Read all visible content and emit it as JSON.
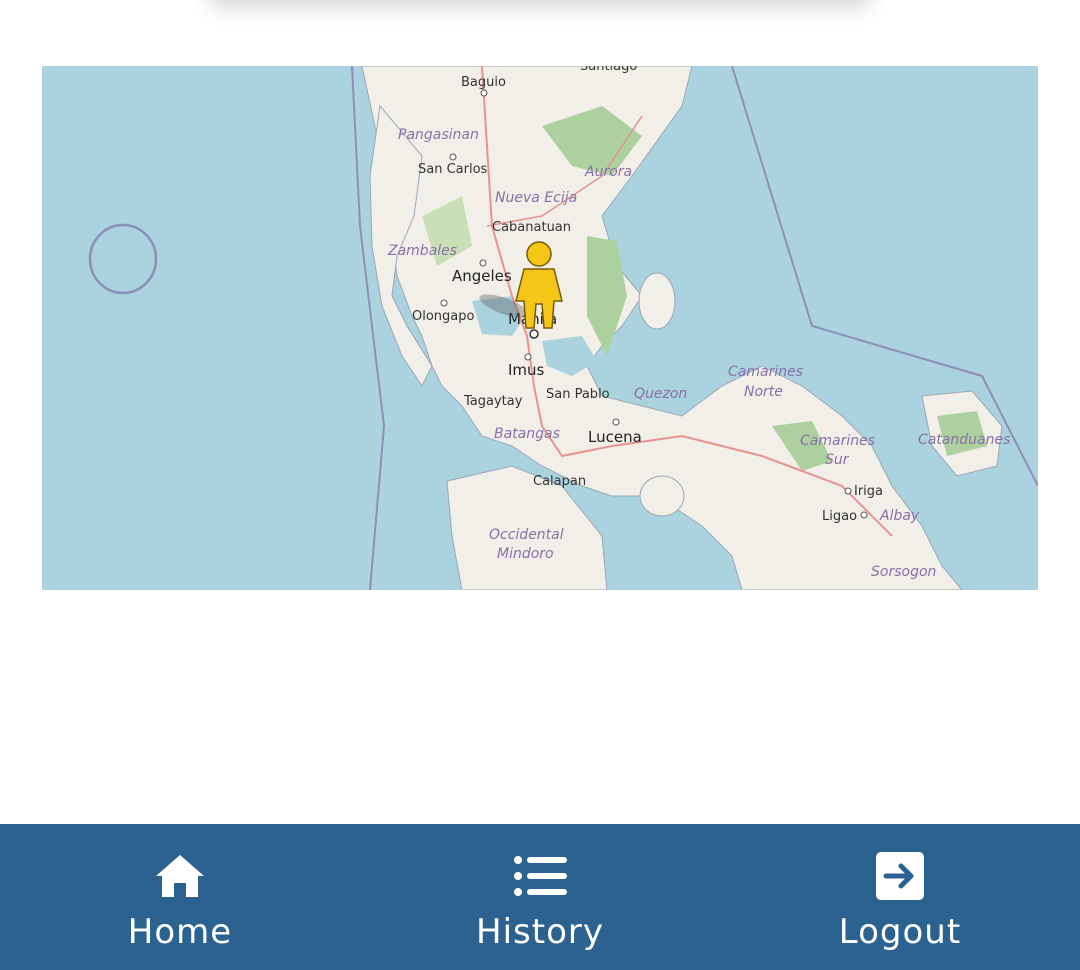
{
  "map": {
    "labels": {
      "santiago": "Santiago",
      "baguio": "Baguio",
      "pangasinan": "Pangasinan",
      "san_carlos": "San Carlos",
      "aurora": "Aurora",
      "nueva_ecija": "Nueva Ecija",
      "cabanatuan": "Cabanatuan",
      "zambales": "Zambales",
      "angeles": "Angeles",
      "olongapo": "Olongapo",
      "manila": "Manila",
      "imus": "Imus",
      "tagaytay": "Tagaytay",
      "san_pablo": "San Pablo",
      "quezon": "Quezon",
      "batangas": "Batangas",
      "lucena": "Lucena",
      "camarines_norte_1": "Camarines",
      "camarines_norte_2": "Norte",
      "camarines_sur_1": "Camarines",
      "camarines_sur_2": "Sur",
      "catanduanes": "Catanduanes",
      "iriga": "Iriga",
      "ligao": "Ligao",
      "albay": "Albay",
      "calapan": "Calapan",
      "occidental_1": "Occidental",
      "occidental_2": "Mindoro",
      "sorsogon": "Sorsogon"
    },
    "marker_icon": "street-view-person-icon"
  },
  "bottom_nav": {
    "items": [
      {
        "label": "Home",
        "icon": "home-icon"
      },
      {
        "label": "History",
        "icon": "list-icon"
      },
      {
        "label": "Logout",
        "icon": "logout-icon"
      }
    ]
  },
  "colors": {
    "nav_bg": "#2b6290",
    "sea": "#aad3df",
    "land": "#f2efe9",
    "forest": "#add19e",
    "marker": "#f5c518"
  }
}
